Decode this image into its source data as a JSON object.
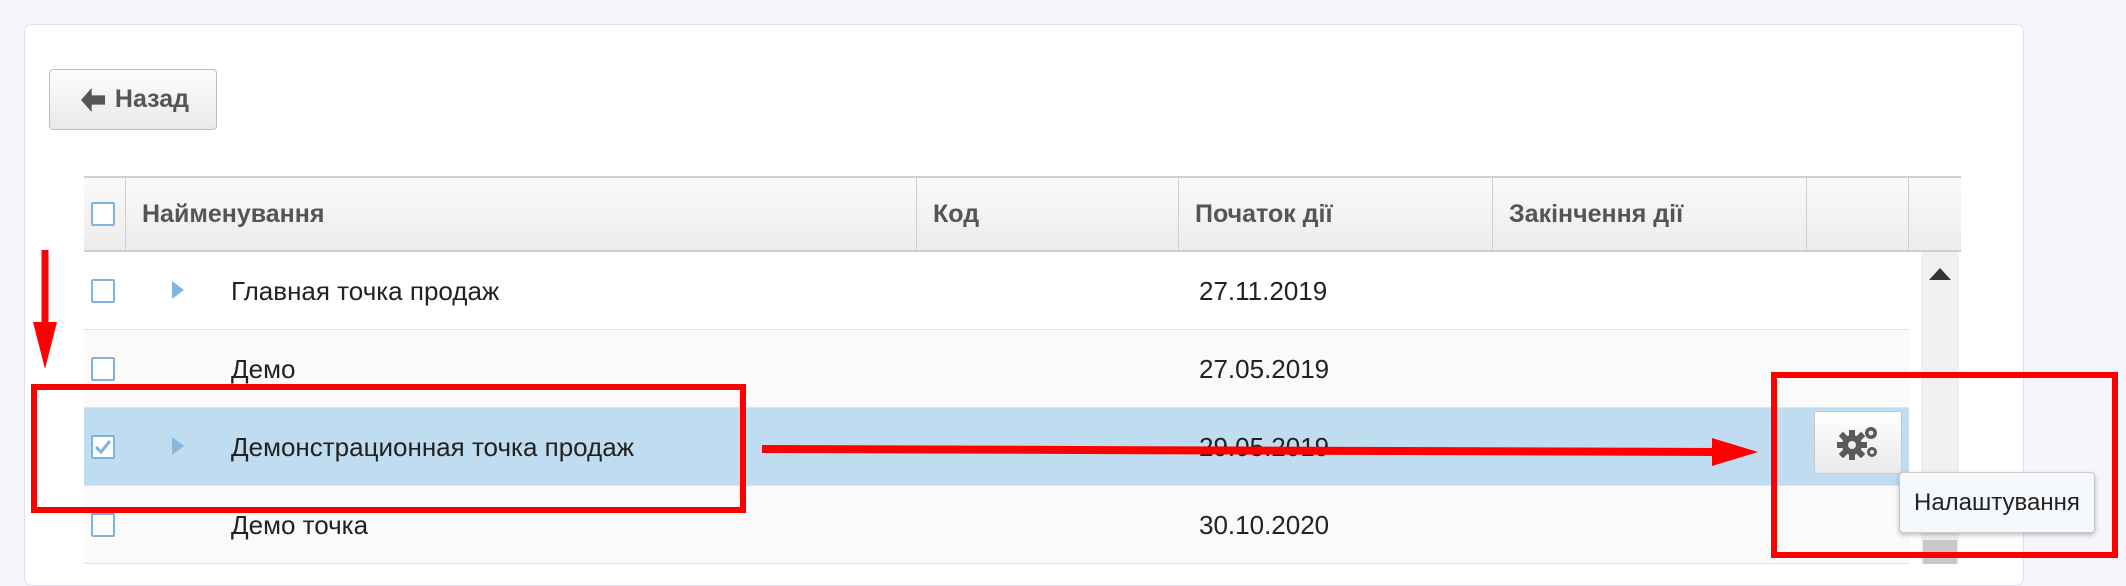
{
  "toolbar": {
    "back_label": "Назад"
  },
  "grid": {
    "columns": [
      {
        "label": "Найменування"
      },
      {
        "label": "Код"
      },
      {
        "label": "Початок дії"
      },
      {
        "label": "Закінчення дії"
      },
      {
        "label": ""
      }
    ],
    "rows": [
      {
        "name": "Главная точка продаж",
        "code": "",
        "start": "27.11.2019",
        "end": "",
        "checked": false,
        "expandable": true
      },
      {
        "name": "Демо",
        "code": "",
        "start": "27.05.2019",
        "end": "",
        "checked": false,
        "expandable": false
      },
      {
        "name": "Демонстрационная точка продаж",
        "code": "",
        "start": "29.05.2019",
        "end": "",
        "checked": true,
        "expandable": true,
        "selected": true
      },
      {
        "name": "Демо точка",
        "code": "",
        "start": "30.10.2020",
        "end": "",
        "checked": false,
        "expandable": false
      }
    ]
  },
  "row_actions": {
    "settings_tooltip": "Налаштування",
    "icon": "gears-icon"
  },
  "annotations": {
    "color": "#ff0000"
  },
  "colors": {
    "selected_row": "#bfdcf1",
    "checkbox_border": "#7fb3df",
    "expander": "#7fb8e6"
  }
}
